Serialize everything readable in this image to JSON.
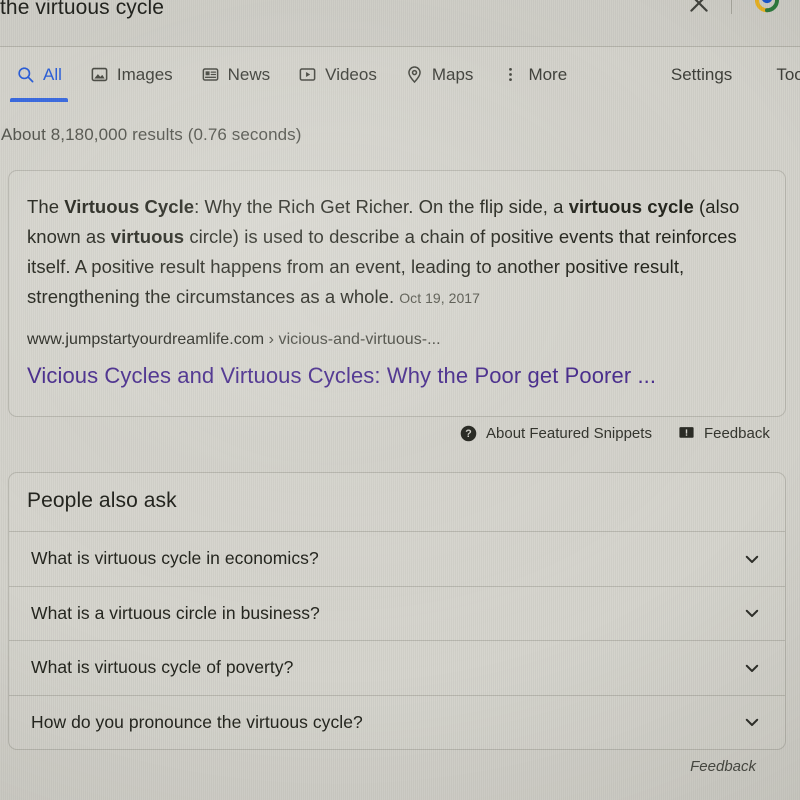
{
  "search": {
    "query": "the virtuous cycle",
    "clear_icon": "close-icon",
    "lens_icon": "google-lens-icon"
  },
  "nav": {
    "tabs": [
      {
        "label": "All",
        "icon": "search-icon",
        "active": true
      },
      {
        "label": "Images",
        "icon": "image-icon",
        "active": false
      },
      {
        "label": "News",
        "icon": "news-icon",
        "active": false
      },
      {
        "label": "Videos",
        "icon": "video-icon",
        "active": false
      },
      {
        "label": "Maps",
        "icon": "map-pin-icon",
        "active": false
      },
      {
        "label": "More",
        "icon": "more-vertical-icon",
        "active": false
      }
    ],
    "settings_label": "Settings",
    "tools_label": "Tools"
  },
  "results": {
    "count_text": "About 8,180,000 results (0.76 seconds)"
  },
  "featured_snippet": {
    "text_parts": [
      {
        "text": "The ",
        "bold": false
      },
      {
        "text": "Virtuous Cycle",
        "bold": true
      },
      {
        "text": ": Why the Rich Get Richer. On the flip side, a ",
        "bold": false
      },
      {
        "text": "virtuous cycle",
        "bold": true
      },
      {
        "text": " (also known as ",
        "bold": false
      },
      {
        "text": "virtuous",
        "bold": true
      },
      {
        "text": " circle) is used to describe a chain of positive events that reinforces itself. A positive result happens from an event, leading to another positive result, strengthening the circumstances as a whole.",
        "bold": false
      }
    ],
    "date": "Oct 19, 2017",
    "url_domain": "www.jumpstartyourdreamlife.com",
    "url_separator": "›",
    "url_path": "vicious-and-virtuous-...",
    "title": "Vicious Cycles and Virtuous Cycles: Why the Poor get Poorer ...",
    "about_label": "About Featured Snippets",
    "about_icon": "help-circle-icon",
    "feedback_label": "Feedback",
    "feedback_icon": "feedback-flag-icon"
  },
  "people_also_ask": {
    "title": "People also ask",
    "questions": [
      {
        "text": "What is virtuous cycle in economics?",
        "expand_icon": "chevron-down-icon"
      },
      {
        "text": "What is a virtuous circle in business?",
        "expand_icon": "chevron-down-icon"
      },
      {
        "text": "What is virtuous cycle of poverty?",
        "expand_icon": "chevron-down-icon"
      },
      {
        "text": "How do you pronounce the virtuous cycle?",
        "expand_icon": "chevron-down-icon"
      }
    ],
    "feedback_label": "Feedback"
  },
  "colors": {
    "page_background": "#d4d3cc",
    "active_tab": "#2b5fd9",
    "link_visited": "#4b2f8f",
    "text_primary": "#26271f",
    "text_secondary": "#54554e",
    "card_border": "#b9b8b0"
  }
}
